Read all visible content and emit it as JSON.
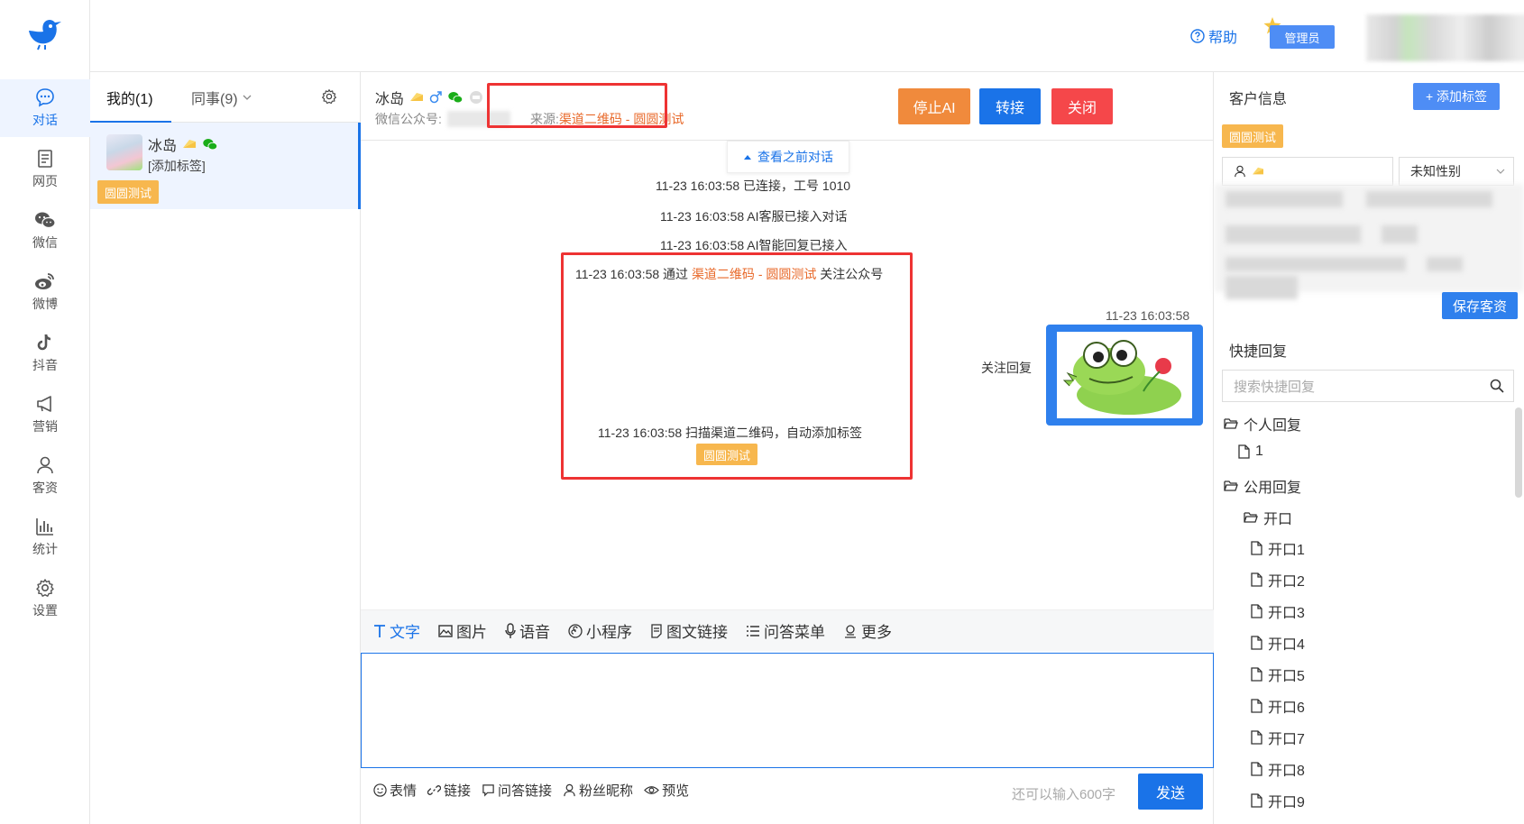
{
  "header": {
    "help_label": "帮助",
    "admin_label": "管理员"
  },
  "nav": {
    "items": [
      {
        "label": "对话",
        "icon": "chat-bubble-icon"
      },
      {
        "label": "网页",
        "icon": "document-icon"
      },
      {
        "label": "微信",
        "icon": "wechat-icon"
      },
      {
        "label": "微博",
        "icon": "weibo-icon"
      },
      {
        "label": "抖音",
        "icon": "tiktok-icon"
      },
      {
        "label": "营销",
        "icon": "megaphone-icon"
      },
      {
        "label": "客资",
        "icon": "user-icon"
      },
      {
        "label": "统计",
        "icon": "bar-chart-icon"
      },
      {
        "label": "设置",
        "icon": "gear-icon"
      }
    ],
    "active_index": 0
  },
  "list": {
    "tab_mine": "我的(1)",
    "tab_colleagues": "同事(9)",
    "conversation": {
      "name": "冰岛",
      "subtitle": "[添加标签]",
      "tag": "圆圆测试"
    }
  },
  "chat": {
    "header": {
      "name": "冰岛",
      "account_label": "微信公众号:",
      "source_label": "来源:",
      "source_value": "渠道二维码 - 圆圆测试"
    },
    "buttons": {
      "stop_ai": "停止AI",
      "transfer": "转接",
      "close": "关闭"
    },
    "history_link": "查看之前对话",
    "system_messages": [
      "11-23 16:03:58 已连接，工号 1010",
      "11-23 16:03:58 AI客服已接入对话",
      "11-23 16:03:58 AI智能回复已接入"
    ],
    "follow_event": {
      "prefix": "11-23 16:03:58 通过 ",
      "channel": "渠道二维码 - 圆圆测试",
      "suffix": " 关注公众号"
    },
    "scan_event": {
      "text": "11-23 16:03:58 扫描渠道二维码，自动添加标签",
      "tag": "圆圆测试"
    },
    "reply": {
      "time": "11-23 16:03:58",
      "label": "关注回复"
    },
    "toolbar": [
      {
        "label": "文字",
        "icon": "text-icon"
      },
      {
        "label": "图片",
        "icon": "image-icon"
      },
      {
        "label": "语音",
        "icon": "microphone-icon"
      },
      {
        "label": "小程序",
        "icon": "miniprogram-icon"
      },
      {
        "label": "图文链接",
        "icon": "article-link-icon"
      },
      {
        "label": "问答菜单",
        "icon": "list-icon"
      },
      {
        "label": "更多",
        "icon": "more-icon"
      }
    ],
    "bottom_tools": [
      {
        "label": "表情",
        "icon": "emoji-icon"
      },
      {
        "label": "链接",
        "icon": "link-icon"
      },
      {
        "label": "问答链接",
        "icon": "qa-link-icon"
      },
      {
        "label": "粉丝昵称",
        "icon": "user-icon"
      },
      {
        "label": "预览",
        "icon": "eye-icon"
      }
    ],
    "remaining": "还可以输入600字",
    "send": "发送"
  },
  "customer": {
    "title": "客户信息",
    "add_tag": "+ 添加标签",
    "tag": "圆圆测试",
    "gender": "未知性别",
    "save": "保存客资"
  },
  "quick_reply": {
    "title": "快捷回复",
    "search_placeholder": "搜索快捷回复",
    "personal_folder": "个人回复",
    "personal_items": [
      "1"
    ],
    "public_folder": "公用回复",
    "sub_folder": "开口",
    "sub_items": [
      "开口1",
      "开口2",
      "开口3",
      "开口4",
      "开口5",
      "开口6",
      "开口7",
      "开口8",
      "开口9"
    ]
  },
  "colors": {
    "primary": "#1a73e8",
    "orange": "#f08a3c",
    "red": "#f5474a",
    "tag": "#f7b74e"
  }
}
